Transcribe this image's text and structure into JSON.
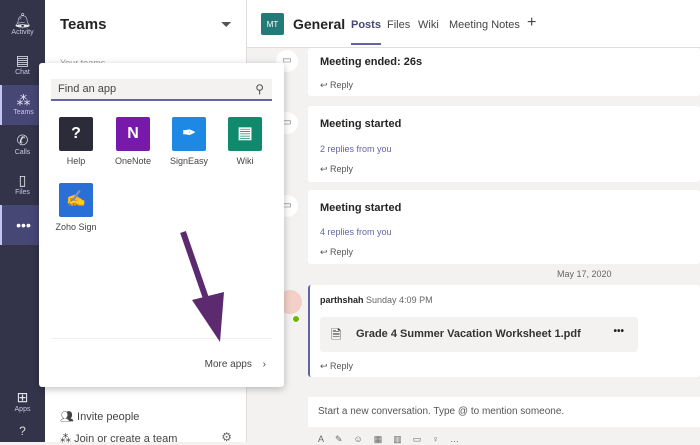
{
  "rail": [
    {
      "label": "Activity",
      "icon": "bell-icon"
    },
    {
      "label": "Chat",
      "icon": "chat-icon"
    },
    {
      "label": "Teams",
      "icon": "teams-icon"
    },
    {
      "label": "Calls",
      "icon": "phone-icon"
    },
    {
      "label": "Files",
      "icon": "file-icon"
    },
    {
      "label": "•••",
      "icon": "more-icon"
    },
    {
      "label": "Apps",
      "icon": "apps-icon"
    },
    {
      "label": "?",
      "icon": "help-icon"
    }
  ],
  "teams": {
    "title": "Teams",
    "your_teams": "Your teams",
    "invite": "Invite people",
    "join": "Join or create a team"
  },
  "header": {
    "avatar": "MT",
    "channel": "General",
    "tabs": [
      "Posts",
      "Files",
      "Wiki",
      "Meeting Notes"
    ],
    "add": "+"
  },
  "popup": {
    "search_placeholder": "Find an app",
    "apps": [
      {
        "name": "Help",
        "glyph": "?",
        "color": "#2b2b3a"
      },
      {
        "name": "OneNote",
        "glyph": "N",
        "color": "#7719aa"
      },
      {
        "name": "SignEasy",
        "glyph": "✒",
        "color": "#1e88e5"
      },
      {
        "name": "Wiki",
        "glyph": "▤",
        "color": "#0f8a6c"
      },
      {
        "name": "Zoho Sign",
        "glyph": "✍",
        "color": "#2a6fd6"
      }
    ],
    "more_apps": "More apps"
  },
  "messages": [
    {
      "title": "Meeting ended: 26s",
      "reply": "Reply"
    },
    {
      "title": "Meeting started",
      "replies": "2 replies from you",
      "reply": "Reply"
    },
    {
      "title": "Meeting started",
      "replies": "4 replies from you",
      "reply": "Reply"
    }
  ],
  "date_divider": "May 17, 2020",
  "post": {
    "author": "parthshah",
    "time": "Sunday 4:09 PM",
    "file": "Grade 4 Summer Vacation Worksheet 1.pdf",
    "more": "•••",
    "reply": "Reply"
  },
  "compose": {
    "placeholder": "Start a new conversation. Type @ to mention someone."
  }
}
